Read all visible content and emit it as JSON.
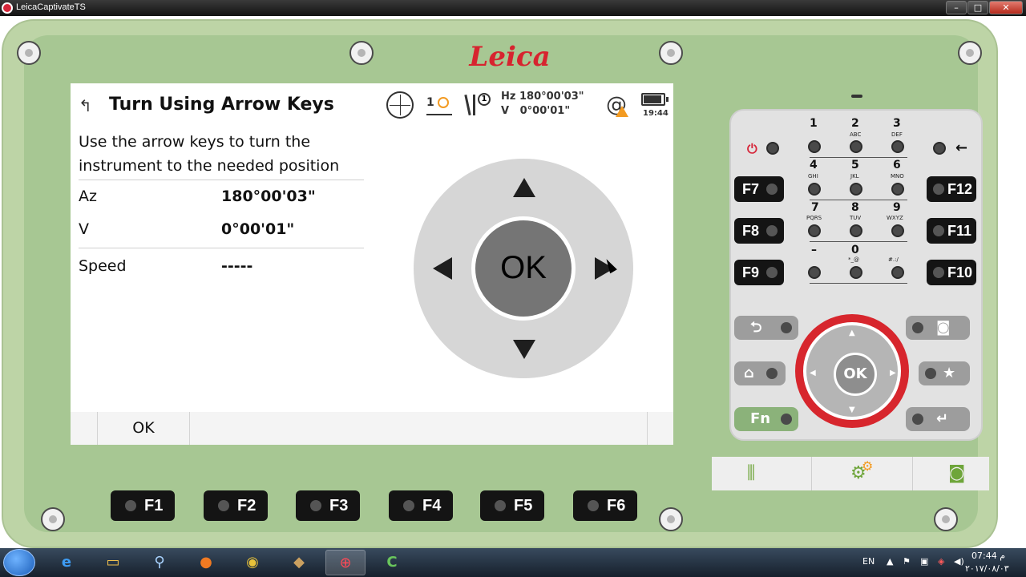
{
  "window": {
    "title": "LeicaCaptivateTS",
    "controls": {
      "minimize": "–",
      "maximize": "□",
      "close": "✕"
    }
  },
  "device": {
    "logo": "Leica"
  },
  "screen": {
    "title": "Turn Using Arrow Keys",
    "status": {
      "prism_count": "1",
      "tripod_count": "1",
      "hz": "Hz 180°00'03\"",
      "v": "V   0°00'01\"",
      "time": "19:44"
    },
    "instruction": "Use the arrow keys to turn the instrument to the needed position",
    "rows": [
      {
        "label": "Az",
        "value": "180°00'03\""
      },
      {
        "label": "V",
        "value": "0°00'01\""
      },
      {
        "label": "Speed",
        "value": "-----"
      }
    ],
    "pad_ok": "OK",
    "softkeys": [
      "OK",
      "",
      ""
    ]
  },
  "keypad": {
    "keys": [
      {
        "num": "1",
        "sub": ""
      },
      {
        "num": "2",
        "sub": "ABC"
      },
      {
        "num": "3",
        "sub": "DEF"
      },
      {
        "num": "4",
        "sub": "GHI"
      },
      {
        "num": "5",
        "sub": "JKL"
      },
      {
        "num": "6",
        "sub": "MNO"
      },
      {
        "num": "7",
        "sub": "PQRS"
      },
      {
        "num": "8",
        "sub": "TUV"
      },
      {
        "num": "9",
        "sub": "WXYZ"
      },
      {
        "num": "–",
        "sub": ""
      },
      {
        "num": "0",
        "sub": "*_@"
      },
      {
        "num": "",
        "sub": "#.:/"
      }
    ],
    "fkeys_left": [
      "F7",
      "F8",
      "F9"
    ],
    "fkeys_right": [
      "F12",
      "F11",
      "F10"
    ],
    "nav_ok": "OK",
    "fn_label": "Fn"
  },
  "bottom_fkeys": [
    "F1",
    "F2",
    "F3",
    "F4",
    "F5",
    "F6"
  ],
  "taskbar": {
    "lang": "EN",
    "time": "07:44 م",
    "date": "٢٠١٧/٠٨/٠٣"
  }
}
